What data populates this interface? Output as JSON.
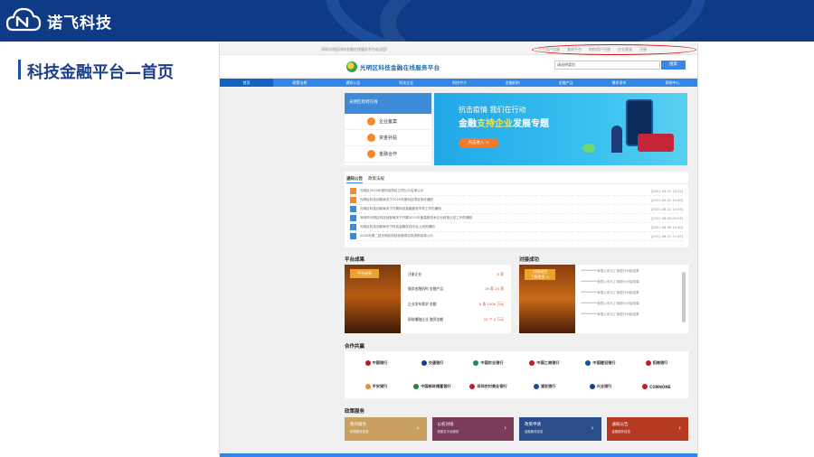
{
  "brand": {
    "name": "诺飞科技"
  },
  "section_title": "科技金融平台—首页",
  "site": {
    "topbar_left": "深圳光明区科技金融在线服务平台欢迎您!",
    "topbar_links": [
      "个人用户注册",
      "查询平台",
      "机构用户注册",
      "企业登录",
      "注册"
    ],
    "title": "光明区科技金融在线服务平台",
    "search": {
      "value": "请选择类别",
      "button": "搜索"
    },
    "nav": [
      "首页",
      "政策法规",
      "通知公告",
      "科技企业",
      "科技中介",
      "金融机构",
      "金融产品",
      "需求发布",
      "帮助中心"
    ],
    "side_panel": {
      "header": "光明区政府在线",
      "items": [
        "企业备案",
        "资金补贴",
        "金融合作"
      ]
    },
    "banner": {
      "line1": "抗击疫情 我们在行动",
      "line2_prefix": "金融",
      "line2_highlight": "支持企业",
      "line2_suffix": "发展专题",
      "button": "点击进入 >"
    },
    "news": {
      "tabs": [
        "通知公告",
        "政策法规"
      ],
      "rows": [
        {
          "text": "光明区2020年度科技项目立项公示名单公示",
          "date": "[2021-09-01 10:22]"
        },
        {
          "text": "光明区科技创新局关于2020年度科技项目验收通知",
          "date": "[2021-09-01 10:00]"
        },
        {
          "text": "光明区科技创新局关于开展科技金融服务专项工作的通知",
          "date": "[2021-08-31 14:53]"
        },
        {
          "text": "深圳市光明区科技创新局关于开展2021年度高新技术企业培育认定工作的通知",
          "date": "[2021-08-30 09:23]"
        },
        {
          "text": "光明区科技创新局关于科技金融在线平台上线的通知",
          "date": "[2021-08-26 15:40]"
        },
        {
          "text": "2020年第二批光明区科技创新项目拟资助名单公示",
          "date": "[2021-08-12 11:55]"
        }
      ]
    },
    "platform_results": {
      "title": "平台成果",
      "badge": "平台成果",
      "lines": [
        {
          "label": "注册企业",
          "value": "0 家"
        },
        {
          "label": "服务金融机构 金融产品",
          "value": "19 家 20 项"
        },
        {
          "label": "企业发布需求 金额",
          "value": "0 条 1000 万元"
        },
        {
          "label": "帮助撮融企业 融资金额",
          "value": "15 个 0 万元"
        }
      ]
    },
    "match_results": {
      "title": "对接成功",
      "badge_line1": "对接成功",
      "badge_line2": "了解更多 >",
      "items": [
        "**********有限公司与工商银行对接成果",
        "**********有限公司与工商银行对接成果",
        "**********有限公司与工商银行对接成果",
        "**********有限公司与工商银行对接成果",
        "**********有限公司与工商银行对接成果",
        "**********有限公司与工商银行对接成果"
      ]
    },
    "partners": {
      "title": "合作共赢",
      "items": [
        {
          "name": "中国银行",
          "color": "#b51c26"
        },
        {
          "name": "交通银行",
          "color": "#1a3f8a"
        },
        {
          "name": "中国农业银行",
          "color": "#1a8a5a"
        },
        {
          "name": "中国工商银行",
          "color": "#c41c2a"
        },
        {
          "name": "中国建设银行",
          "color": "#1a4f9a"
        },
        {
          "name": "招商银行",
          "color": "#c41c2a"
        },
        {
          "name": "平安银行",
          "color": "#f08a2b"
        },
        {
          "name": "中国邮政储蓄银行",
          "color": "#1a8a3a"
        },
        {
          "name": "深圳农村商业银行",
          "color": "#c41c2a"
        },
        {
          "name": "浦发银行",
          "color": "#1a4f9a"
        },
        {
          "name": "兴业银行",
          "color": "#1a3f8a"
        },
        {
          "name": "CONNONE",
          "color": "#c41c2a"
        }
      ]
    },
    "services": {
      "title": "政策服务",
      "items": [
        {
          "title": "我的服务",
          "sub": "政策服务信息",
          "color": "#c9a060"
        },
        {
          "title": "以权对接",
          "sub": "政策至平台服务",
          "color": "#7a3a5a"
        },
        {
          "title": "政策申请",
          "sub": "金融服务信息",
          "color": "#2a4e8a"
        },
        {
          "title": "通知公告",
          "sub": "金融服务信息",
          "color": "#b63a22"
        }
      ]
    }
  }
}
